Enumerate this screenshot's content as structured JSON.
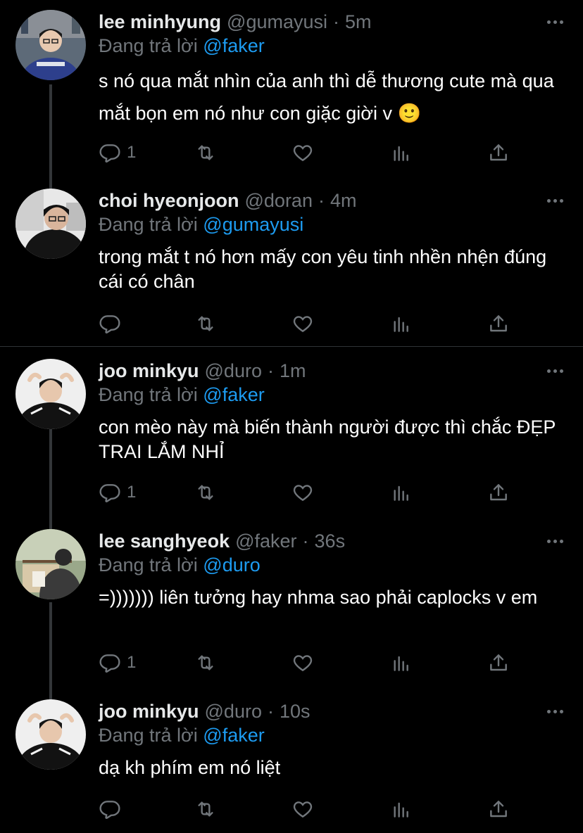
{
  "reply_prefix": "Đang trả lời",
  "tweets": [
    {
      "name": "lee minhyung",
      "handle": "@gumayusi",
      "time": "5m",
      "reply_to": "@faker",
      "text": "s nó qua mắt nhìn của anh thì dễ thương cute mà qua mắt bọn em nó như con giặc giời v 🙂",
      "reply_count": "1"
    },
    {
      "name": "choi hyeonjoon",
      "handle": "@doran",
      "time": "4m",
      "reply_to": "@gumayusi",
      "text": "trong mắt t nó hơn mấy con yêu tinh nhền nhện đúng cái có chân",
      "reply_count": ""
    },
    {
      "name": "joo minkyu",
      "handle": "@duro",
      "time": "1m",
      "reply_to": "@faker",
      "text": "con mèo này mà biến thành người được thì chắc ĐẸP TRAI LẮM NHỈ",
      "reply_count": "1"
    },
    {
      "name": "lee sanghyeok",
      "handle": "@faker",
      "time": "36s",
      "reply_to": "@duro",
      "text": "=))))))) liên tưởng hay nhma sao phải caplocks v em",
      "reply_count": "1"
    },
    {
      "name": "joo minkyu",
      "handle": "@duro",
      "time": "10s",
      "reply_to": "@faker",
      "text": "dạ kh phím em nó liệt",
      "reply_count": ""
    }
  ],
  "icons": {
    "reply": "reply-icon",
    "retweet": "retweet-icon",
    "like": "heart-icon",
    "views": "analytics-icon",
    "share": "share-icon",
    "more": "more-icon"
  },
  "colors": {
    "background": "#000000",
    "text": "#ffffff",
    "muted": "#71767b",
    "mention": "#1d9bf0",
    "thread_line": "#333639"
  }
}
